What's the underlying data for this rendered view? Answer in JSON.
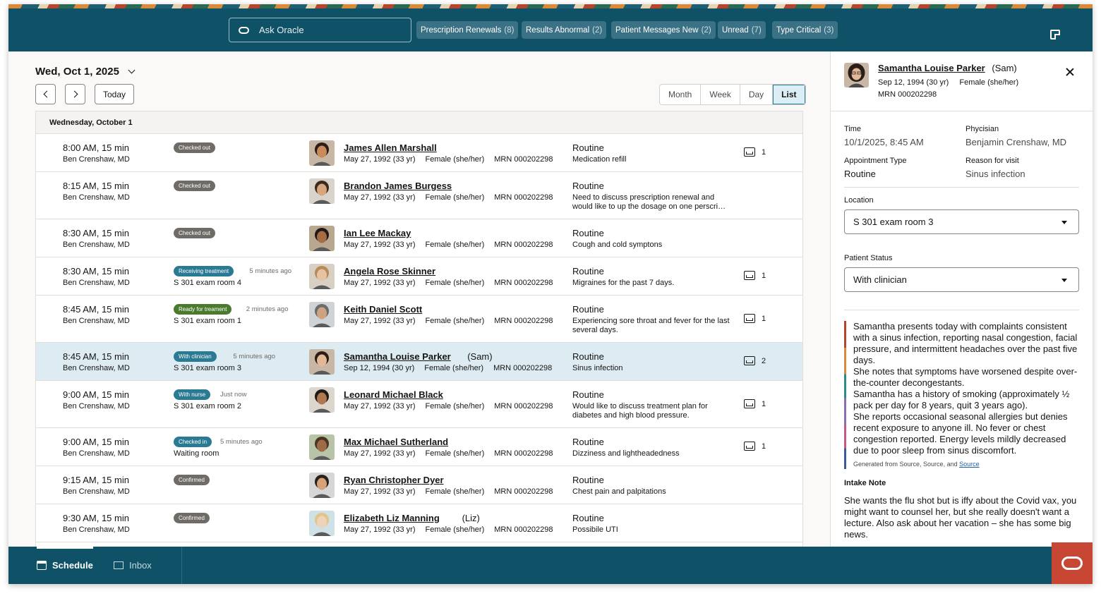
{
  "topbar": {
    "ask_placeholder": "Ask Oracle",
    "chips": [
      {
        "label": "Prescription Renewals",
        "count": "(8)"
      },
      {
        "label": "Results Abnormal",
        "count": "(2)"
      },
      {
        "label": "Patient Messages New",
        "count": "(2)"
      },
      {
        "label": "Unread",
        "count": "(7)"
      },
      {
        "label": "Type Critical",
        "count": "(3)"
      }
    ]
  },
  "schedule": {
    "date_title": "Wed, Oct 1, 2025",
    "today_label": "Today",
    "views": [
      "Month",
      "Week",
      "Day",
      "List"
    ],
    "active_view": "List",
    "day_header": "Wednesday, October 1",
    "rows": [
      {
        "time": "8:00 AM,",
        "dur": "15 min",
        "doctor": "Ben Crenshaw, MD",
        "status": "Checked out",
        "status_color": "#6f6b67",
        "ago": "",
        "room": "",
        "name": "James Allen Marshall",
        "nick": "",
        "dob": "May 27, 1992 (33 yr)",
        "sex": "Female (she/her)",
        "mrn": "MRN 000202298",
        "type": "Routine",
        "reason": "Medication refill",
        "inbox": "1"
      },
      {
        "time": "8:15 AM,",
        "dur": "15 min",
        "doctor": "Ben Crenshaw, MD",
        "status": "Checked out",
        "status_color": "#6f6b67",
        "ago": "",
        "room": "",
        "name": "Brandon James Burgess",
        "nick": "",
        "dob": "May 27, 1992 (33 yr)",
        "sex": "Female (she/her)",
        "mrn": "MRN 000202298",
        "type": "Routine",
        "reason": "Need to discuss prescription renewal and would like to up the dosage on one perscri…",
        "inbox": ""
      },
      {
        "time": "8:30 AM,",
        "dur": "15 min",
        "doctor": "Ben Crenshaw, MD",
        "status": "Checked out",
        "status_color": "#6f6b67",
        "ago": "",
        "room": "",
        "name": "Ian Lee Mackay",
        "nick": "",
        "dob": "May 27, 1992 (33 yr)",
        "sex": "Female (she/her)",
        "mrn": "MRN 000202298",
        "type": "Routine",
        "reason": "Cough and cold symptons",
        "inbox": ""
      },
      {
        "time": "8:30 AM,",
        "dur": "15 min",
        "doctor": "Ben Crenshaw, MD",
        "status": "Receiving treatment",
        "status_color": "#2a7a93",
        "ago": "5 minutes ago",
        "room": "S 301 exam room 4",
        "name": "Angela Rose Skinner",
        "nick": "",
        "dob": "May 27, 1992 (33 yr)",
        "sex": "Female (she/her)",
        "mrn": "MRN 000202298",
        "type": "Routine",
        "reason": "Migraines for the past 7 days.",
        "inbox": "1"
      },
      {
        "time": "8:45 AM,",
        "dur": "15 min",
        "doctor": "Ben Crenshaw, MD",
        "status": "Ready for treament",
        "status_color": "#4a7a2e",
        "ago": "2 minutes ago",
        "room": "S 301 exam room 1",
        "name": "Keith Daniel Scott",
        "nick": "",
        "dob": "May 27, 1992 (33 yr)",
        "sex": "Female (she/her)",
        "mrn": "MRN 000202298",
        "type": "Routine",
        "reason": "Experiencing sore throat and fever for the last several days.",
        "inbox": "1"
      },
      {
        "time": "8:45 AM,",
        "dur": "15 min",
        "doctor": "Ben Crenshaw, MD",
        "status": "With clinician",
        "status_color": "#2a7a93",
        "ago": "5 minutes ago",
        "room": "S 301 exam room 3",
        "name": "Samantha Louise Parker",
        "nick": "(Sam)",
        "dob": "Sep 12, 1994 (30 yr)",
        "sex": "Female (she/her)",
        "mrn": "MRN 000202298",
        "type": "Routine",
        "reason": "Sinus infection",
        "inbox": "2"
      },
      {
        "time": "9:00 AM,",
        "dur": "15 min",
        "doctor": "Ben Crenshaw, MD",
        "status": "With nurse",
        "status_color": "#2a7a93",
        "ago": "Just now",
        "room": "S 301 exam room 2",
        "name": "Leonard Michael Black",
        "nick": "",
        "dob": "May 27, 1992 (33 yr)",
        "sex": "Female (she/her)",
        "mrn": "MRN 000202298",
        "type": "Routine",
        "reason": "Would like to discuss treatment plan for diabetes and high blood pressure.",
        "inbox": "1"
      },
      {
        "time": "9:00 AM,",
        "dur": "15 min",
        "doctor": "Ben Crenshaw, MD",
        "status": "Checked in",
        "status_color": "#2a7a93",
        "ago": "5 minutes ago",
        "room": "Waiting room",
        "name": "Max Michael Sutherland",
        "nick": "",
        "dob": "May 27, 1992 (33 yr)",
        "sex": "Female (she/her)",
        "mrn": "MRN 000202298",
        "type": "Routine",
        "reason": "Dizziness and lightheadedness",
        "inbox": "1"
      },
      {
        "time": "9:15 AM,",
        "dur": "15 min",
        "doctor": "Ben Crenshaw, MD",
        "status": "Confirmed",
        "status_color": "#6f6b67",
        "ago": "",
        "room": "",
        "name": "Ryan Christopher Dyer",
        "nick": "",
        "dob": "May 27, 1992 (33 yr)",
        "sex": "Female (she/her)",
        "mrn": "MRN 000202298",
        "type": "Routine",
        "reason": "Chest pain and palpitations",
        "inbox": ""
      },
      {
        "time": "9:30 AM,",
        "dur": "15 min",
        "doctor": "Ben Crenshaw, MD",
        "status": "Confirmed",
        "status_color": "#6f6b67",
        "ago": "",
        "room": "",
        "name": "Elizabeth Liz Manning",
        "nick": "(Liz)",
        "dob": "May 27, 1992 (33 yr)",
        "sex": "Female (she/her)",
        "mrn": "MRN 000202298",
        "type": "Routine",
        "reason": "Possibile UTI",
        "inbox": ""
      }
    ]
  },
  "panel": {
    "name": "Samantha Louise Parker",
    "nick": "(Sam)",
    "dob": "Sep 12, 1994 (30 yr)",
    "sex": "Female (she/her)",
    "mrn": "MRN 000202298",
    "time_label": "Time",
    "time_value": "10/1/2025, 8:45 AM",
    "physician_label": "Phycisian",
    "physician_value": "Benjamin Crenshaw, MD",
    "appt_type_label": "Appointment Type",
    "appt_type_value": "Routine",
    "reason_label": "Reason for visit",
    "reason_value": "Sinus infection",
    "location_label": "Location",
    "location_value": "S 301 exam room 3",
    "status_label": "Patient Status",
    "status_value": "With clinician",
    "summary": "Samantha presents today with complaints consistent with a sinus infection, reporting nasal congestion, facial pressure, and intermittent headaches over the past five days.\nShe notes that symptoms have worsened despite over-the-counter decongestants.\nSamantha has a history of smoking (approximately ½ pack per day for 8 years, quit 3 years ago).\nShe reports occasional seasonal allergies but denies recent exposure to anyone ill. No fever or chest congestion reported. Energy levels mildly decreased due to poor sleep from sinus discomfort.",
    "generated_prefix": "Generated from Source, Source, and",
    "generated_link": "Source",
    "intake_label": "Intake Note",
    "intake_text": "She wants the flu shot but is iffy about the Covid vax, you might want to counsel her, but she really doesn't want a lecture. Also ask about her vacation – she has some big news."
  },
  "bottom": {
    "schedule_label": "Schedule",
    "inbox_label": "Inbox"
  },
  "colors": {
    "brand_bar": "#0f5167",
    "oracle_red": "#c74634",
    "selected_row": "#dcecf2"
  }
}
